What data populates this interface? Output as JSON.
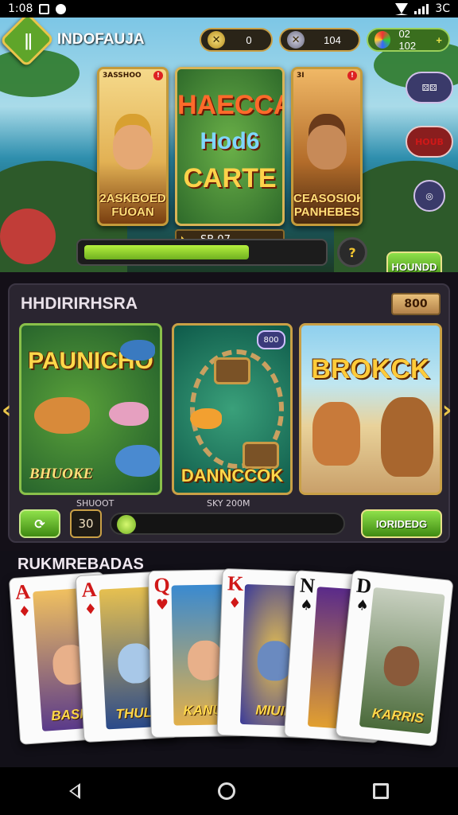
{
  "status_bar": {
    "time": "1:08",
    "right_text": "3C"
  },
  "header": {
    "title": "INDOFAUJA",
    "coins_value": "0",
    "gems_value": "104",
    "balance_value": "02 102",
    "plus_label": "+"
  },
  "featured": [
    {
      "badge": "3ASSHOO",
      "caption_line1": "2ASKBOED",
      "caption_line2": "FUOAN"
    },
    {
      "title_line1": "HAECCA",
      "title_line2": "Hod6",
      "title_line3": "CARTE",
      "price": "SB 07"
    },
    {
      "badge": "3I",
      "caption_line1": "CEASOSIOK",
      "caption_line2": "PANHEBES"
    }
  ],
  "side_buttons": [
    "",
    "HOUB",
    ""
  ],
  "top_action_button": "HOUNDD",
  "top_progress": 0.7,
  "panel": {
    "title": "HHDIRIRHSRA",
    "badge": "800",
    "tiles": [
      {
        "title": "PAUNICHO",
        "subtitle": "BHUOKE"
      },
      {
        "title": "DANNCCOK",
        "badge": "800"
      },
      {
        "title": "BROKCK"
      }
    ],
    "tile_label_1": "SHUOOT",
    "tile_label_2": "SKY 200M",
    "counter": "30",
    "slider": 0.02,
    "action_button": "IORIDEDG"
  },
  "cards_section": {
    "title": "RUKMREBADAS",
    "cards": [
      {
        "rank": "A",
        "suit": "♦",
        "color": "red",
        "label": "BASKO"
      },
      {
        "rank": "A",
        "suit": "♦",
        "color": "red",
        "label": "THULLI"
      },
      {
        "rank": "Q",
        "suit": "♥",
        "color": "red",
        "label": "KANUB"
      },
      {
        "rank": "K",
        "suit": "♦",
        "color": "red",
        "label": "MIUIB"
      },
      {
        "rank": "N",
        "suit": "♠",
        "color": "black",
        "label": ""
      },
      {
        "rank": "D",
        "suit": "♠",
        "color": "black",
        "label": "KARRIS"
      }
    ]
  },
  "colors": {
    "accent_green": "#6fb020",
    "gold": "#c9a046",
    "panel_bg": "#2a2530"
  }
}
